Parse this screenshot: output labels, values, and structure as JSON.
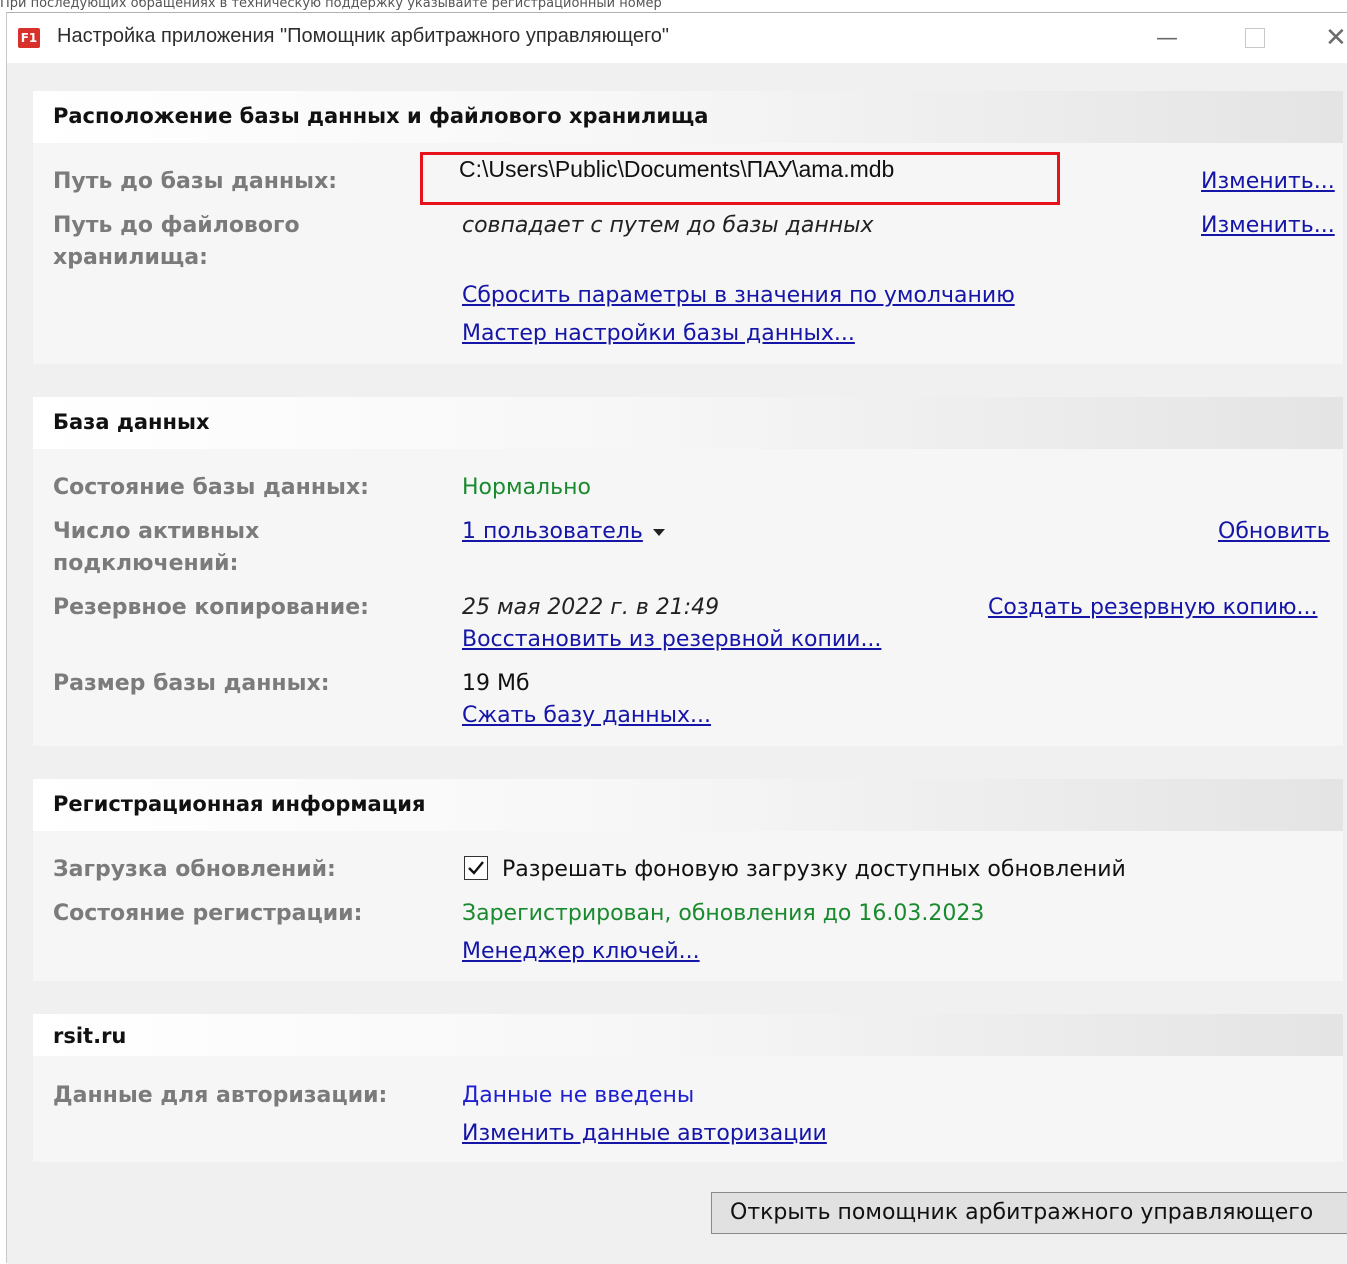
{
  "top_strip_text": "При последующих обращениях в техническую поддержку указывайте регистрационный номер",
  "window": {
    "icon_text": "F1",
    "title": "Настройка приложения \"Помощник арбитражного управляющего\"",
    "minimize": "—",
    "close": "✕"
  },
  "location": {
    "header": "Расположение базы данных и файлового хранилища",
    "db_path_label": "Путь до базы данных:",
    "db_path_value": "C:\\Users\\Public\\Documents\\ПАУ\\ama.mdb",
    "change_db": "Изменить...",
    "storage_label": "Путь до файлового хранилища:",
    "storage_value": "совпадает с путем до базы данных",
    "change_storage": "Изменить...",
    "reset_link": "Сбросить параметры в значения по умолчанию",
    "wizard_link": "Мастер настройки базы данных..."
  },
  "database": {
    "header": "База данных",
    "state_label": "Состояние базы данных:",
    "state_value": "Нормально",
    "connections_label": "Число активных подключений:",
    "connections_value": "1 пользователь",
    "refresh_link": "Обновить",
    "backup_label": "Резервное копирование:",
    "backup_value": "25 мая 2022 г. в 21:49",
    "create_backup_link": "Создать резервную копию...",
    "restore_link": "Восстановить из резервной копии...",
    "size_label": "Размер базы данных:",
    "size_value": "19 Мб",
    "compress_link": "Сжать базу данных..."
  },
  "registration": {
    "header": "Регистрационная информация",
    "updates_label": "Загрузка обновлений:",
    "updates_checkbox_checked": true,
    "updates_checkbox_label": "Разрешать фоновую загрузку доступных обновлений",
    "status_label": "Состояние регистрации:",
    "status_value": "Зарегистрирован, обновления до 16.03.2023",
    "keys_link": "Менеджер ключей..."
  },
  "rsit": {
    "header": "rsit.ru",
    "auth_label": "Данные для авторизации:",
    "auth_value": "Данные не введены",
    "change_auth_link": "Изменить данные авторизации"
  },
  "open_button": "Открыть помощник арбитражного управляющего"
}
